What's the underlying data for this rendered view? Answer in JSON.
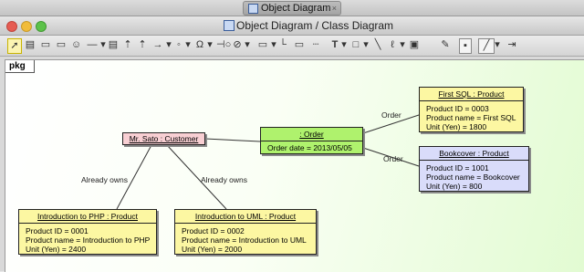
{
  "outer_tab": {
    "label": "Object Diagram"
  },
  "window": {
    "title": "Object Diagram / Class Diagram"
  },
  "toolbar": {
    "text_tool": "T"
  },
  "frame": {
    "label": "pkg"
  },
  "objects": {
    "customer": {
      "header": "Mr. Sato : Customer"
    },
    "order": {
      "header": ": Order",
      "attrs": [
        "Order date = 2013/05/05"
      ]
    },
    "first_sql": {
      "header": "First SQL : Product",
      "attrs": [
        "Product ID = 0003",
        "Product name = First SQL",
        "Unit (Yen) = 1800"
      ]
    },
    "bookcover": {
      "header": "Bookcover : Product",
      "attrs": [
        "Product ID = 1001",
        "Product name = Bookcover",
        "Unit (Yen) = 800"
      ]
    },
    "intro_php": {
      "header": "Introduction to PHP : Product",
      "attrs": [
        "Product ID = 0001",
        "Product name = Introduction to PHP",
        "Unit (Yen) = 2400"
      ]
    },
    "intro_uml": {
      "header": "Introduction to UML : Product",
      "attrs": [
        "Product ID = 0002",
        "Product name = Introduction to UML",
        "Unit (Yen) = 2000"
      ]
    }
  },
  "links": {
    "order_first_sql": "Order",
    "order_bookcover": "Order",
    "owns_php": "Already owns",
    "owns_uml": "Already owns"
  },
  "colors": {
    "product": "#fcf7a2",
    "customer": "#f8cfd3",
    "order": "#aff26d",
    "selected_product": "#d9dcfa"
  }
}
